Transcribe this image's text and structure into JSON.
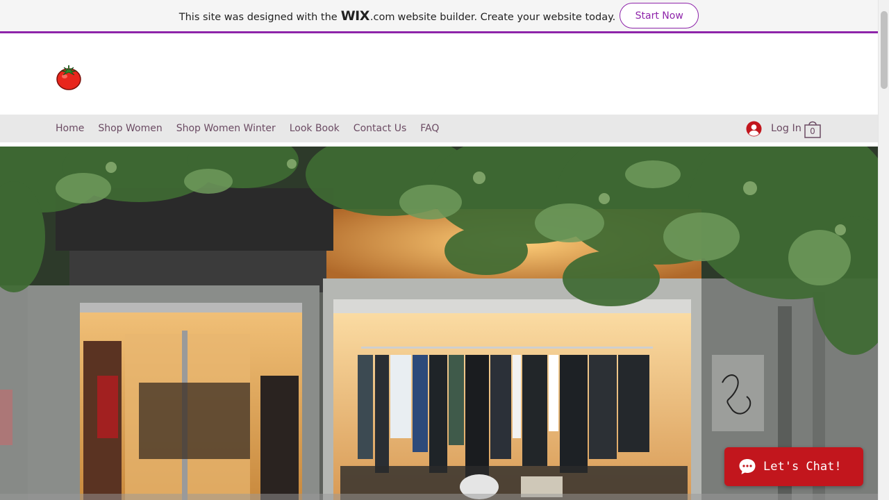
{
  "banner": {
    "text_before": "This site was designed with the",
    "wix_logo": "WIX",
    "wix_suffix": ".com",
    "text_after": "website builder. Create your website today.",
    "cta_label": "Start Now",
    "accent_color": "#8e24aa"
  },
  "header": {
    "logo_icon": "tomato-logo"
  },
  "nav": {
    "items": [
      {
        "label": "Home"
      },
      {
        "label": "Shop Women"
      },
      {
        "label": "Shop Women Winter"
      },
      {
        "label": "Look Book"
      },
      {
        "label": "Contact Us"
      },
      {
        "label": "FAQ"
      }
    ],
    "login_label": "Log In",
    "login_icon": "avatar-icon",
    "cart_icon": "shopping-bag-icon",
    "cart_count": "0",
    "text_color": "#6b4b63",
    "bar_color": "#e8e8e8"
  },
  "hero": {
    "image": "storefront-with-ivy-photo"
  },
  "chat": {
    "label": "Let's Chat!",
    "icon": "chat-bubble-icon",
    "color": "#c2161d"
  }
}
